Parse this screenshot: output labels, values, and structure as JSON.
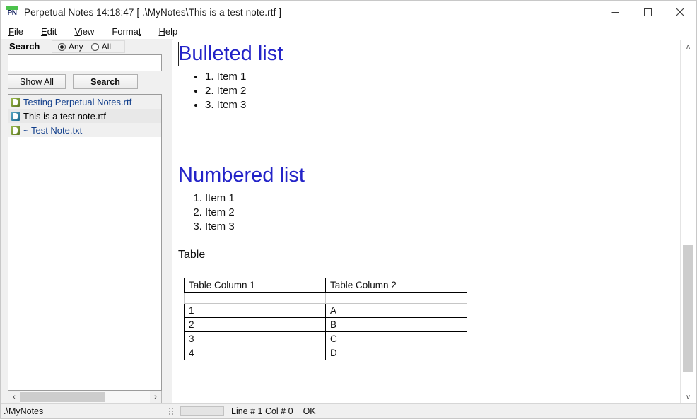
{
  "window": {
    "app_icon_label": "PN",
    "title": "Perpetual Notes 14:18:47 [ .\\MyNotes\\This is a test note.rtf ]",
    "minimize_label": "minimize",
    "maximize_label": "maximize",
    "close_label": "close"
  },
  "menubar": {
    "items": [
      {
        "pre": "",
        "accel": "F",
        "post": "ile"
      },
      {
        "pre": "",
        "accel": "E",
        "post": "dit"
      },
      {
        "pre": "",
        "accel": "V",
        "post": "iew"
      },
      {
        "pre": "Forma",
        "accel": "t",
        "post": ""
      },
      {
        "pre": "",
        "accel": "H",
        "post": "elp"
      }
    ]
  },
  "sidebar": {
    "search_label": "Search",
    "scope_options": [
      {
        "label": "Any",
        "selected": true
      },
      {
        "label": "All",
        "selected": false
      }
    ],
    "search_value": "",
    "search_placeholder": "",
    "show_all_label": "Show All",
    "search_button_label": "Search",
    "files": [
      {
        "name": "Testing Perpetual Notes.rtf",
        "icon": "rtf-document-icon",
        "icon_color": "#7d9a36",
        "selected": false
      },
      {
        "name": "This is a test note.rtf",
        "icon": "rtf-document-icon",
        "icon_color": "#2e7fa0",
        "selected": true
      },
      {
        "name": "~ Test Note.txt",
        "icon": "txt-document-icon",
        "icon_color": "#7d9a36",
        "selected": false
      }
    ],
    "hscroll": {
      "left_arrow": "‹",
      "right_arrow": "›",
      "thumb_percent": 66
    }
  },
  "editor": {
    "heading_color": "#2323c8",
    "blocks": [
      {
        "type": "h1",
        "text": "Bulleted list"
      },
      {
        "type": "ul",
        "items": [
          "1. Item 1",
          "2. Item 2",
          "3. Item 3"
        ]
      },
      {
        "type": "h1",
        "text": "Numbered list"
      },
      {
        "type": "ol",
        "items": [
          "Item 1",
          "Item 2",
          "Item 3"
        ]
      },
      {
        "type": "p",
        "text": "Table"
      }
    ],
    "table": {
      "headers": [
        "Table Column 1",
        "Table Column 2"
      ],
      "empty_row": [
        "",
        ""
      ],
      "rows": [
        [
          "1",
          "A"
        ],
        [
          "2",
          "B"
        ],
        [
          "3",
          "C"
        ],
        [
          "4",
          "D"
        ]
      ]
    },
    "vscroll": {
      "up_arrow": "∧",
      "down_arrow": "∨"
    }
  },
  "statusbar": {
    "path": ".\\MyNotes",
    "line_col": "Line # 1 Col # 0",
    "state": "OK"
  }
}
